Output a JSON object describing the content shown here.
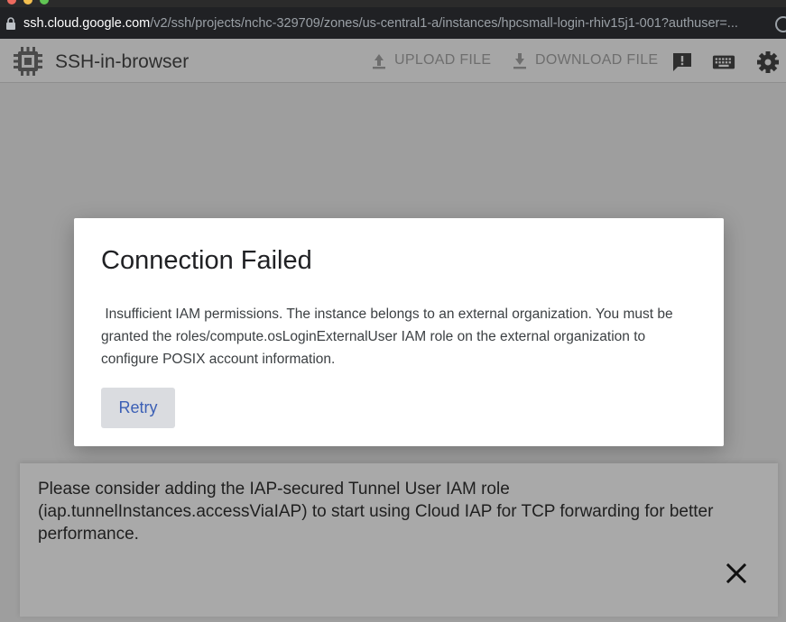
{
  "browser": {
    "url_host": "ssh.cloud.google.com",
    "url_path": "/v2/ssh/projects/nchc-329709/zones/us-central1-a/instances/hpcsmall-login-rhiv15j1-001?authuser=..."
  },
  "header": {
    "title": "SSH-in-browser",
    "upload_label": "UPLOAD FILE",
    "download_label": "DOWNLOAD FILE",
    "icons": [
      "chip-icon",
      "upload-icon",
      "download-icon",
      "feedback-icon",
      "keyboard-icon",
      "settings-icon"
    ]
  },
  "dialog": {
    "title": "Connection Failed",
    "message": " Insufficient IAM permissions. The instance belongs to an external organization. You must be granted the roles/compute.osLoginExternalUser IAM role on the external organization to configure POSIX account information.",
    "retry_label": "Retry"
  },
  "snackbar": {
    "message": "Please consider adding the IAP-secured Tunnel User IAM role (iap.tunnelInstances.accessViaIAP) to start using Cloud IAP for TCP forwarding for better performance."
  },
  "colors": {
    "overlay": "#9e9e9e",
    "accent": "#3b5fb5",
    "dialog_bg": "#ffffff"
  }
}
